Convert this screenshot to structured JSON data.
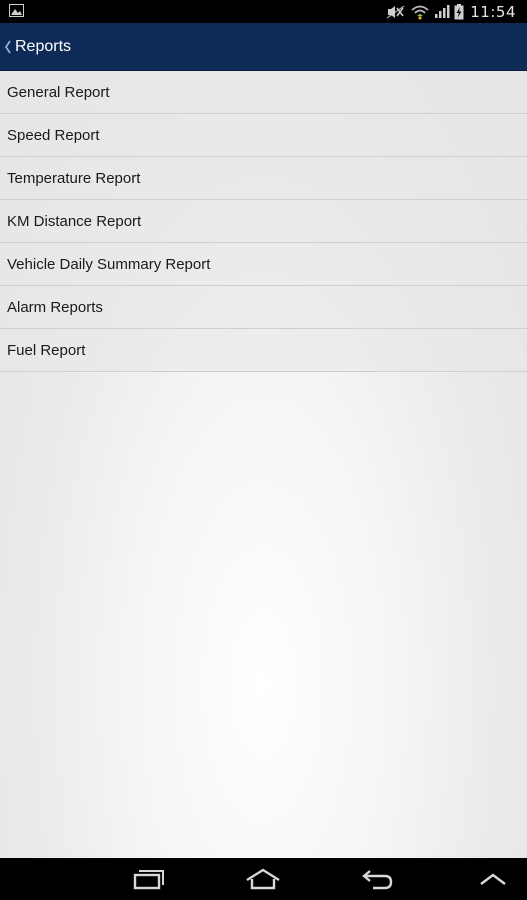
{
  "status_bar": {
    "time": "11:54",
    "icons": [
      "gallery-notification-icon",
      "mute-icon",
      "wifi-icon",
      "signal-icon",
      "battery-charging-icon"
    ]
  },
  "action_bar": {
    "title": "Reports",
    "background": "#0e2a57"
  },
  "reports": {
    "items": [
      {
        "label": "General Report"
      },
      {
        "label": "Speed Report"
      },
      {
        "label": "Temperature Report"
      },
      {
        "label": "KM Distance Report"
      },
      {
        "label": "Vehicle Daily Summary Report"
      },
      {
        "label": "Alarm Reports"
      },
      {
        "label": "Fuel Report"
      }
    ]
  },
  "nav_bar": {
    "icons": [
      "recent-apps-icon",
      "home-icon",
      "back-icon",
      "hide-keyboard-icon"
    ]
  }
}
